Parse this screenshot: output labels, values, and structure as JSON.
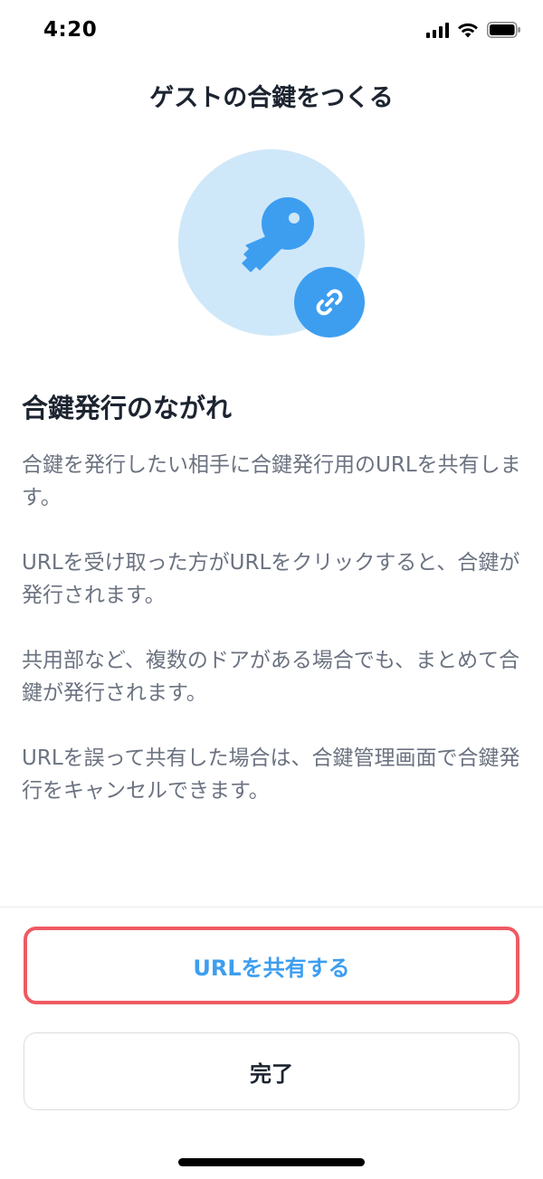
{
  "status_bar": {
    "time": "4:20"
  },
  "header": {
    "title": "ゲストの合鍵をつくる"
  },
  "hero": {
    "main_icon": "key-icon",
    "badge_icon": "link-icon",
    "circle_color": "#cfe8f9",
    "accent_color": "#3d9ef0"
  },
  "content": {
    "heading": "合鍵発行のながれ",
    "paragraphs": [
      "合鍵を発行したい相手に合鍵発行用のURLを共有します。",
      "URLを受け取った方がURLをクリックすると、合鍵が発行されます。",
      "共用部など、複数のドアがある場合でも、まとめて合鍵が発行されます。",
      "URLを誤って共有した場合は、合鍵管理画面で合鍵発行をキャンセルできます。"
    ]
  },
  "actions": {
    "share_label": "URLを共有する",
    "done_label": "完了"
  }
}
